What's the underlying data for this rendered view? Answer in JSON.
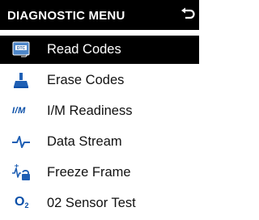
{
  "header": {
    "title": "DIAGNOSTIC MENU",
    "back_icon": "return-arrow-icon"
  },
  "colors": {
    "header_bg": "#000000",
    "header_text": "#ffffff",
    "selected_bg": "#000000",
    "selected_text": "#ffffff",
    "item_text": "#111111",
    "icon_blue": "#0a4fa8"
  },
  "menu": {
    "selected_index": 0,
    "items": [
      {
        "label": "Read Codes",
        "icon": "dtc-read-codes-icon"
      },
      {
        "label": "Erase Codes",
        "icon": "eraser-icon"
      },
      {
        "label": "I/M Readiness",
        "icon": "im-readiness-icon",
        "icon_text": "I/M"
      },
      {
        "label": "Data Stream",
        "icon": "waveform-icon"
      },
      {
        "label": "Freeze Frame",
        "icon": "freeze-frame-icon"
      },
      {
        "label": "02 Sensor Test",
        "icon": "o2-sensor-icon",
        "icon_text": "O",
        "icon_subtext": "2"
      }
    ]
  }
}
